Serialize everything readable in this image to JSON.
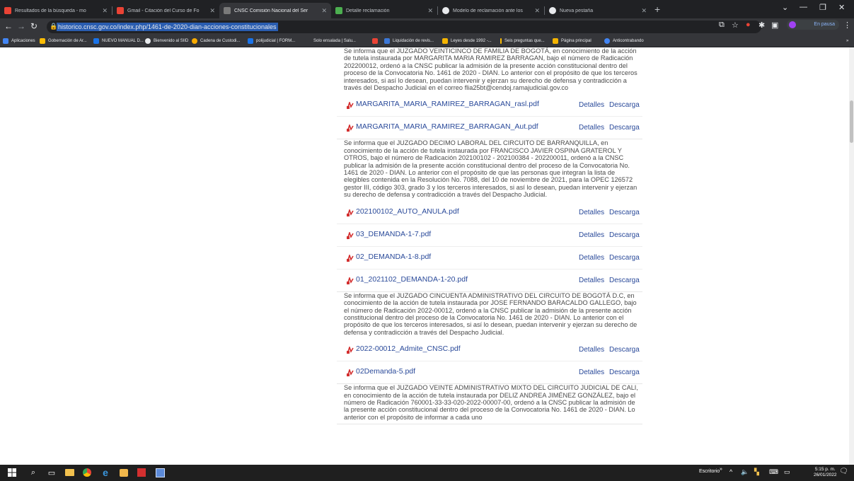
{
  "browser": {
    "tabs": [
      {
        "title": "Resultados de la búsqueda - mo",
        "icon": "gmail-icon",
        "color": "#ea4335"
      },
      {
        "title": "Gmail - Citación del Curso de Fo",
        "icon": "gmail-icon",
        "color": "#ea4335"
      },
      {
        "title": "CNSC Comisión Nacional del Ser",
        "icon": "cnsc-icon",
        "color": "#7a7a7a"
      },
      {
        "title": "Detalle reclamación",
        "icon": "leaf-icon",
        "color": "#4caf50"
      },
      {
        "title": "Modelo de reclamación ante los",
        "icon": "globe-icon",
        "color": "#e8eaed"
      },
      {
        "title": "Nueva pestaña",
        "icon": "chrome-icon",
        "color": "#e8eaed"
      }
    ],
    "url": "historico.cnsc.gov.co/index.php/1461-de-2020-dian-acciones-constitucionales",
    "profile_label": "En pausa",
    "bookmarks": [
      {
        "label": "Aplicaciones",
        "color": "#4285f4"
      },
      {
        "label": "Gobernación de Ar...",
        "color": "#fbbc05"
      },
      {
        "label": "NUEVO MANUAL D...",
        "color": "#1a73e8"
      },
      {
        "label": "Bienvenido al SIID",
        "color": "#e8eaed"
      },
      {
        "label": "Cadena de Custodi...",
        "color": "#f9ab00"
      },
      {
        "label": "polijudicial | FORM...",
        "color": "#1a73e8"
      },
      {
        "label": "Solo ensalada | Salu...",
        "color": "#e8eaed"
      },
      {
        "label": "",
        "color": "#ea4335"
      },
      {
        "label": "Liquidación de revis...",
        "color": "#3c78d8"
      },
      {
        "label": "Leyes desde 1992 -...",
        "color": "#f4b400"
      },
      {
        "label": "Seis preguntas que...",
        "color": "#fbbc05"
      },
      {
        "label": "Página principal",
        "color": "#f4b400"
      },
      {
        "label": "Anticontrabando",
        "color": "#4285f4"
      }
    ]
  },
  "labels": {
    "details": "Detalles",
    "download": "Descarga"
  },
  "sections": [
    {
      "notice": "Se informa que el JUZGADO VEINTICINCO DE FAMILIA DE BOGOTÁ, en conocimiento de la acción de tutela instaurada por MARGARITA MARIA RAMIREZ BARRAGAN, bajo el número de Radicación 202200012, ordenó a la CNSC publicar la admisión de la presente acción constitucional dentro del proceso de la Convocatoria No. 1461 de 2020 - DIAN. Lo anterior con el propósito de que los terceros interesados, si así lo desean, puedan intervenir y ejerzan su derecho de defensa y contradicción a través del Despacho Judicial en el correo flia25bt@cendoj.ramajudicial.gov.co",
      "files": [
        "MARGARITA_MARIA_RAMIREZ_BARRAGAN_rasl.pdf",
        "MARGARITA_MARIA_RAMIREZ_BARRAGAN_Aut.pdf"
      ]
    },
    {
      "notice": "Se informa que el JUZGADO DECIMO LABORAL DEL CIRCUITO DE BARRANQUILLA, en conocimiento de la acción de tutela instaurada por FRANCISCO JAVIER OSPINA GRATEROL Y OTROS, bajo el número de Radicación 202100102 - 202100384 - 202200011, ordenó a la CNSC publicar la admisión de la presente acción constitucional dentro del proceso de la Convocatoria No. 1461 de 2020 - DIAN. Lo anterior con el propósito de que las personas que integran la lista de elegibles contenida en la Resolución No. 7088, del 10 de noviembre de 2021, para la OPEC 126572 gestor III, código 303, grado 3 y los terceros interesados, si así lo desean, puedan intervenir y ejerzan su derecho de defensa y contradicción a través del Despacho Judicial.",
      "files": [
        "202100102_AUTO_ANULA.pdf",
        "03_DEMANDA-1-7.pdf",
        "02_DEMANDA-1-8.pdf",
        "01_2021102_DEMANDA-1-20.pdf"
      ]
    },
    {
      "notice": "Se informa que el JUZGADO CINCUENTA ADMINISTRATIVO DEL CIRCUITO DE BOGOTÁ D.C, en conocimiento de la acción de tutela instaurada por JOSE FERNANDO BARACALDO GALLEGO, bajo el número de Radicación 2022-00012, ordenó a la CNSC publicar la admisión de la presente acción constitucional dentro del proceso de la Convocatoria No. 1461 de 2020 - DIAN. Lo anterior con el propósito de que los terceros interesados, si así lo desean, puedan intervenir y ejerzan su derecho de defensa y contradicción a través del Despacho Judicial.",
      "files": [
        "2022-00012_Admite_CNSC.pdf",
        "02Demanda-5.pdf"
      ]
    },
    {
      "notice": "Se informa que el JUZGADO VEINTE ADMINISTRATIVO MIXTO DEL CIRCUITO JUDICIAL DE CALI, en conocimiento de la acción de tutela instaurada por DELIZ ANDREA JIMÉNEZ GONZÁLEZ, bajo el número de Radicación 760001-33-33-020-2022-00007-00, ordenó a la CNSC publicar la admisión de la presente acción constitucional dentro del proceso de la Convocatoria No. 1461 de 2020 - DIAN. Lo anterior con el propósito de informar a cada uno",
      "files": []
    }
  ],
  "taskbar": {
    "desktop_label": "Escritorio",
    "time": "5:15 p. m.",
    "date": "26/01/2022"
  }
}
